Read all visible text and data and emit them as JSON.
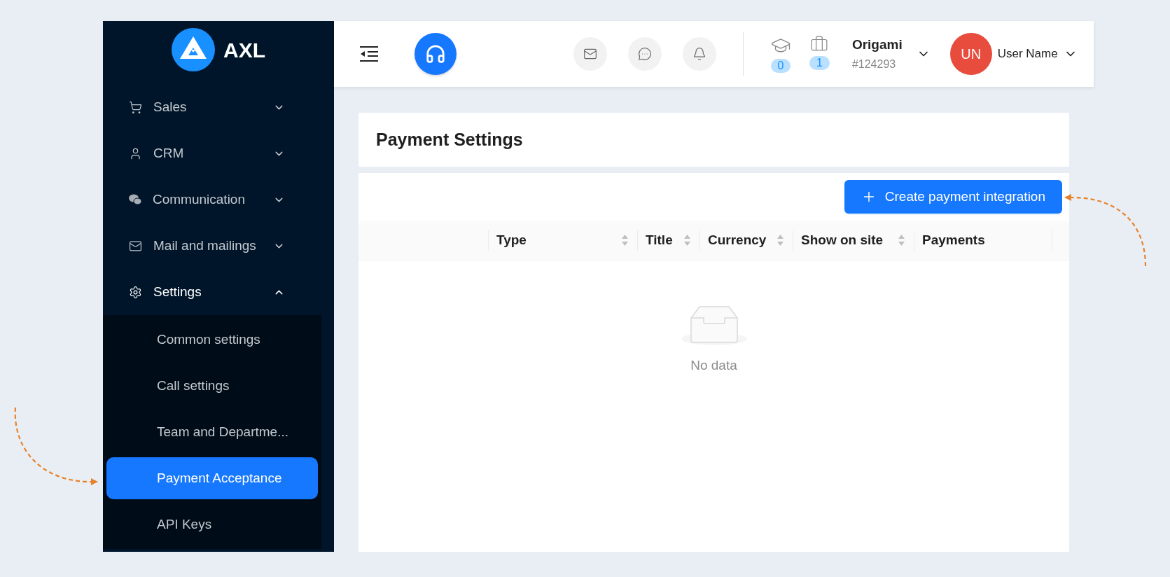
{
  "sidebar": {
    "logo_text": "AXL",
    "items": [
      {
        "label": "Sales",
        "expanded": false
      },
      {
        "label": "CRM",
        "expanded": false
      },
      {
        "label": "Communication",
        "expanded": false
      },
      {
        "label": "Mail and mailings",
        "expanded": false
      },
      {
        "label": "Settings",
        "expanded": true,
        "children": [
          {
            "label": "Common settings",
            "selected": false
          },
          {
            "label": "Call settings",
            "selected": false
          },
          {
            "label": "Team and Departme...",
            "selected": false
          },
          {
            "label": "Payment Acceptance",
            "selected": true
          },
          {
            "label": "API Keys",
            "selected": false
          }
        ]
      }
    ]
  },
  "header": {
    "counters": [
      "0",
      "1"
    ],
    "company": {
      "name": "Origami",
      "id": "#124293"
    },
    "user": {
      "initials": "UN",
      "name": "User Name"
    }
  },
  "page": {
    "title": "Payment Settings",
    "create_button": "Create payment integration",
    "table": {
      "columns": [
        {
          "sortable": false
        },
        {
          "label": "Type",
          "sortable": true
        },
        {
          "label": "Title",
          "sortable": true
        },
        {
          "label": "Currency",
          "sortable": true
        },
        {
          "label": "Show on site",
          "sortable": true
        },
        {
          "label": "Payments",
          "sortable": false
        }
      ],
      "empty_text": "No data"
    }
  }
}
